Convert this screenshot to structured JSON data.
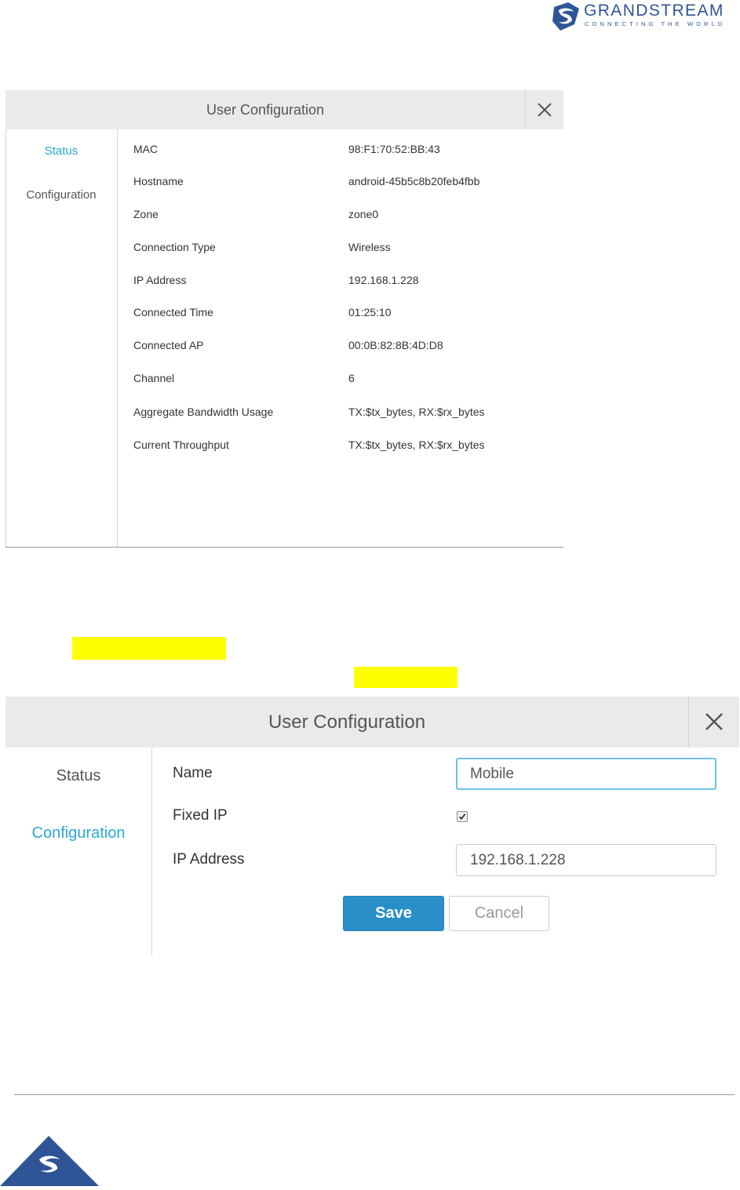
{
  "brand": {
    "name": "GRANDSTREAM",
    "tagline": "CONNECTING THE WORLD",
    "color": "#2f5597"
  },
  "status_dialog": {
    "title": "User Configuration",
    "sidebar": [
      {
        "label": "Status",
        "active": true
      },
      {
        "label": "Configuration",
        "active": false
      }
    ],
    "rows": [
      {
        "label": "MAC",
        "value": "98:F1:70:52:BB:43"
      },
      {
        "label": "Hostname",
        "value": "android-45b5c8b20feb4fbb"
      },
      {
        "label": "Zone",
        "value": "zone0"
      },
      {
        "label": "Connection Type",
        "value": "Wireless"
      },
      {
        "label": "IP Address",
        "value": "192.168.1.228"
      },
      {
        "label": "Connected Time",
        "value": "01:25:10"
      },
      {
        "label": "Connected AP",
        "value": "00:0B:82:8B:4D:D8"
      },
      {
        "label": "Channel",
        "value": "6"
      },
      {
        "label": "Aggregate Bandwidth Usage",
        "value": "TX:$tx_bytes, RX:$rx_bytes"
      },
      {
        "label": "Current Throughput",
        "value": "TX:$tx_bytes, RX:$rx_bytes"
      }
    ]
  },
  "config_dialog": {
    "title": "User Configuration",
    "sidebar": [
      {
        "label": "Status",
        "active": false
      },
      {
        "label": "Configuration",
        "active": true
      }
    ],
    "name_label": "Name",
    "name_value": "Mobile",
    "fixed_ip_label": "Fixed IP",
    "fixed_ip_checked": true,
    "ip_label": "IP Address",
    "ip_value": "192.168.1.228",
    "save_label": "Save",
    "cancel_label": "Cancel"
  },
  "colors": {
    "accent": "#2aa7d6",
    "save_button": "#2a8fc9",
    "header_bg": "#e8eaeb",
    "highlight": "#ffff00"
  },
  "icons": [
    "logo-icon",
    "close-icon",
    "checkmark-icon",
    "footer-logo-icon"
  ]
}
